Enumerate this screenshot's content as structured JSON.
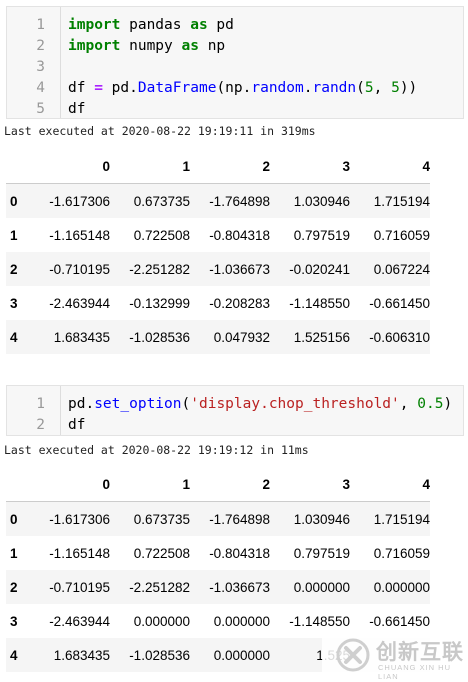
{
  "cells": [
    {
      "lines": [
        {
          "no": "1",
          "parts": [
            [
              "kw",
              "import"
            ],
            [
              "t",
              " pandas "
            ],
            [
              "kw",
              "as"
            ],
            [
              "t",
              " pd"
            ]
          ]
        },
        {
          "no": "2",
          "parts": [
            [
              "kw",
              "import"
            ],
            [
              "t",
              " numpy "
            ],
            [
              "kw",
              "as"
            ],
            [
              "t",
              " np"
            ]
          ]
        },
        {
          "no": "3",
          "parts": []
        },
        {
          "no": "4",
          "parts": [
            [
              "t",
              "df "
            ],
            [
              "op",
              "="
            ],
            [
              "t",
              " pd."
            ],
            [
              "fn",
              "DataFrame"
            ],
            [
              "t",
              "(np."
            ],
            [
              "fn",
              "random"
            ],
            [
              "t",
              "."
            ],
            [
              "fn",
              "randn"
            ],
            [
              "t",
              "("
            ],
            [
              "num",
              "5"
            ],
            [
              "t",
              ", "
            ],
            [
              "num",
              "5"
            ],
            [
              "t",
              "))"
            ]
          ]
        },
        {
          "no": "5",
          "parts": [
            [
              "t",
              "df"
            ]
          ]
        }
      ],
      "status": "Last executed at 2020-08-22 19:19:11 in 319ms"
    },
    {
      "lines": [
        {
          "no": "1",
          "parts": [
            [
              "t",
              "pd."
            ],
            [
              "fn",
              "set_option"
            ],
            [
              "t",
              "("
            ],
            [
              "str",
              "'display.chop_threshold'"
            ],
            [
              "t",
              ", "
            ],
            [
              "num",
              "0.5"
            ],
            [
              "t",
              ")"
            ]
          ]
        },
        {
          "no": "2",
          "parts": [
            [
              "t",
              "df"
            ]
          ]
        }
      ],
      "status": "Last executed at 2020-08-22 19:19:12 in 11ms"
    }
  ],
  "tables": [
    {
      "columns": [
        "0",
        "1",
        "2",
        "3",
        "4"
      ],
      "rows": [
        {
          "index": "0",
          "values": [
            "-1.617306",
            "0.673735",
            "-1.764898",
            "1.030946",
            "1.715194"
          ]
        },
        {
          "index": "1",
          "values": [
            "-1.165148",
            "0.722508",
            "-0.804318",
            "0.797519",
            "0.716059"
          ]
        },
        {
          "index": "2",
          "values": [
            "-0.710195",
            "-2.251282",
            "-1.036673",
            "-0.020241",
            "0.067224"
          ]
        },
        {
          "index": "3",
          "values": [
            "-2.463944",
            "-0.132999",
            "-0.208283",
            "-1.148550",
            "-0.661450"
          ]
        },
        {
          "index": "4",
          "values": [
            "1.683435",
            "-1.028536",
            "0.047932",
            "1.525156",
            "-0.606310"
          ]
        }
      ]
    },
    {
      "columns": [
        "0",
        "1",
        "2",
        "3",
        "4"
      ],
      "rows": [
        {
          "index": "0",
          "values": [
            "-1.617306",
            "0.673735",
            "-1.764898",
            "1.030946",
            "1.715194"
          ]
        },
        {
          "index": "1",
          "values": [
            "-1.165148",
            "0.722508",
            "-0.804318",
            "0.797519",
            "0.716059"
          ]
        },
        {
          "index": "2",
          "values": [
            "-0.710195",
            "-2.251282",
            "-1.036673",
            "0.000000",
            "0.000000"
          ]
        },
        {
          "index": "3",
          "values": [
            "-2.463944",
            "0.000000",
            "0.000000",
            "-1.148550",
            "-0.661450"
          ]
        },
        {
          "index": "4",
          "values": [
            "1.683435",
            "-1.028536",
            "0.000000",
            "1.525",
            ""
          ]
        }
      ]
    }
  ],
  "watermark": {
    "cn": "创新互联",
    "en": "CHUANG XIN HU LIAN",
    "icon": "x-logo-icon"
  }
}
